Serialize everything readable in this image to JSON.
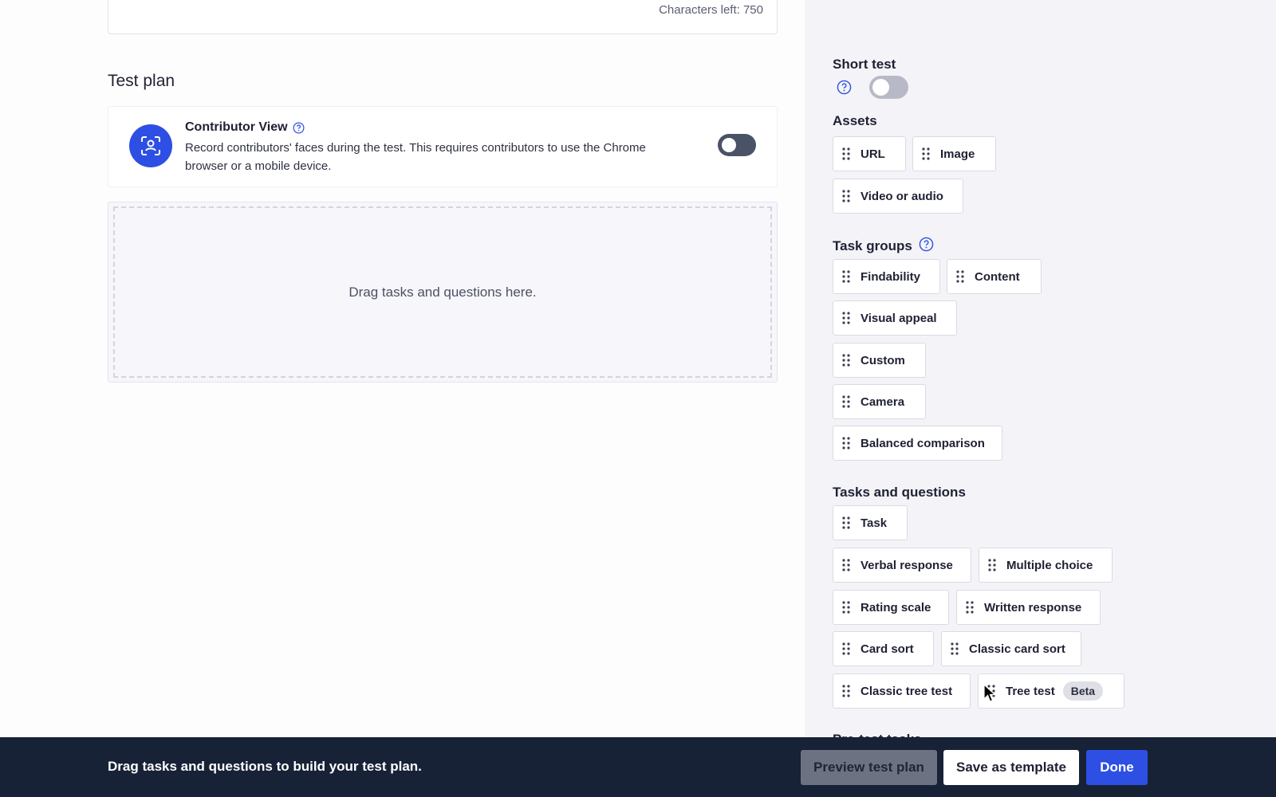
{
  "description_box": {
    "chars_left": "Characters left: 750"
  },
  "test_plan": {
    "title": "Test plan",
    "contributor_view": {
      "title": "Contributor View",
      "description": "Record contributors' faces during the test. This requires contributors to use the Chrome browser or a mobile device.",
      "enabled": false
    },
    "dropzone_text": "Drag tasks and questions here."
  },
  "sidebar": {
    "short_test": {
      "heading": "Short test",
      "enabled": false
    },
    "assets": {
      "heading": "Assets",
      "items": [
        "URL",
        "Image",
        "Video or audio"
      ]
    },
    "task_groups": {
      "heading": "Task groups",
      "items": [
        "Findability",
        "Content",
        "Visual appeal",
        "Custom",
        "Camera",
        "Balanced comparison"
      ]
    },
    "tasks_questions": {
      "heading": "Tasks and questions",
      "items": [
        "Task",
        "Verbal response",
        "Multiple choice",
        "Rating scale",
        "Written response",
        "Card sort",
        "Classic card sort",
        "Classic tree test",
        "Tree test"
      ],
      "tree_test_badge": "Beta"
    },
    "next_heading_partial": "Pre-test tasks"
  },
  "bottom_bar": {
    "message": "Drag tasks and questions to build your test plan.",
    "preview_label": "Preview test plan",
    "save_template_label": "Save as template",
    "done_label": "Done"
  },
  "colors": {
    "accent": "#2d4fe3",
    "bottom_bar_bg": "#172237",
    "sidebar_bg": "#f4f4f8"
  },
  "icons": [
    "help-icon",
    "camera-face-icon",
    "drag-grip-icon",
    "mouse-cursor-icon"
  ]
}
